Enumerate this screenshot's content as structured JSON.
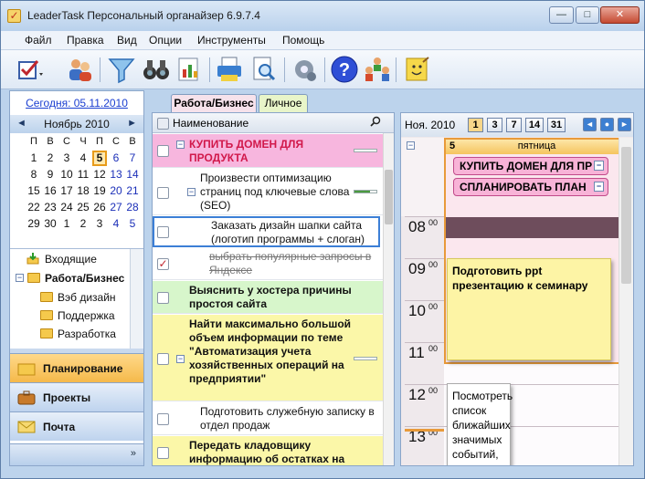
{
  "window": {
    "title": "LeaderTask Персональный органайзер 6.9.7.4",
    "min": "—",
    "max": "□",
    "close": "✕"
  },
  "menu": [
    "Файл",
    "Правка",
    "Вид",
    "Опции",
    "Инструменты",
    "Помощь"
  ],
  "toolbar_icons": [
    "tasks-check-icon",
    "users-icon",
    "filter-icon",
    "binoculars-icon",
    "report-icon",
    "printer-icon",
    "preview-icon",
    "settings-gear-icon",
    "help-icon",
    "people-group-icon",
    "sticky-note-icon"
  ],
  "sidebar": {
    "today_link": "Сегодня: 05.11.2010",
    "calendar": {
      "month": "Ноябрь 2010",
      "prev": "◄",
      "next": "►",
      "dow": [
        "П",
        "В",
        "С",
        "Ч",
        "П",
        "С",
        "В"
      ],
      "weeks": [
        [
          "1",
          "2",
          "3",
          "4",
          "5",
          "6",
          "7"
        ],
        [
          "8",
          "9",
          "10",
          "11",
          "12",
          "13",
          "14"
        ],
        [
          "15",
          "16",
          "17",
          "18",
          "19",
          "20",
          "21"
        ],
        [
          "22",
          "23",
          "24",
          "25",
          "26",
          "27",
          "28"
        ],
        [
          "29",
          "30",
          "1",
          "2",
          "3",
          "4",
          "5"
        ]
      ],
      "selected": "5"
    },
    "folders": [
      {
        "label": "Входящие",
        "bold": false
      },
      {
        "label": "Работа/Бизнес",
        "bold": true
      },
      {
        "label": "Вэб дизайн",
        "bold": false
      },
      {
        "label": "Поддержка",
        "bold": false
      },
      {
        "label": "Разработка",
        "bold": false
      }
    ],
    "nav": [
      "Планирование",
      "Проекты",
      "Почта"
    ],
    "nav_more": "»"
  },
  "tabs": [
    "Работа/Бизнес",
    "Личное"
  ],
  "tasklist": {
    "header": "Наименование",
    "rows": [
      {
        "text": "КУПИТЬ ДОМЕН ДЛЯ ПРОДУКТА",
        "style": "pink",
        "progress": 0
      },
      {
        "text": "Произвести оптимизацию страниц под ключевые слова (SEO)",
        "style": "white",
        "progress": 0.7
      },
      {
        "text": "Заказать дизайн шапки сайта (логотип программы + слоган)",
        "style": "selected",
        "progress": 0
      },
      {
        "text": "выбрать популярные запросы в Яндексе",
        "style": "done",
        "progress": 0
      },
      {
        "text": "Выяснить у хостера причины простоя сайта",
        "style": "green",
        "progress": 0
      },
      {
        "text": "Найти максимально большой объем информации по теме \"Автоматизация учета хозяйственных операций на предприятии\"",
        "style": "yellow",
        "progress": 0
      },
      {
        "text": "Подготовить служебную записку в отдел продаж",
        "style": "white",
        "progress": 0
      },
      {
        "text": "Передать кладовщику информацию об остатках на складе",
        "style": "yellow",
        "progress": 0
      }
    ]
  },
  "dayview": {
    "month": "Ноя. 2010",
    "views": [
      "1",
      "3",
      "7",
      "14",
      "31"
    ],
    "day_number": "5",
    "day_name": "пятница",
    "allday_events": [
      "КУПИТЬ ДОМЕН ДЛЯ ПР",
      "СПЛАНИРОВАТЬ ПЛАН"
    ],
    "hours": [
      {
        "h": "08",
        "m": "00"
      },
      {
        "h": "09",
        "m": "00"
      },
      {
        "h": "10",
        "m": "00"
      },
      {
        "h": "11",
        "m": "00"
      },
      {
        "h": "12",
        "m": "00"
      },
      {
        "h": "13",
        "m": "00"
      }
    ],
    "note1": "Подготовить ppt презентацию к семинару",
    "note2": "Посмотреть список ближайших значимых событий, уточнить их"
  }
}
